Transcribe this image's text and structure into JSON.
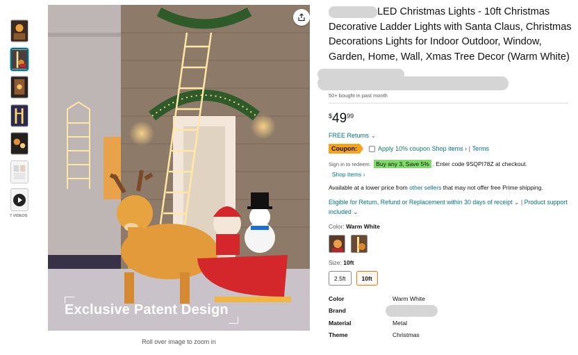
{
  "thumbnails": [
    {
      "name": "thumb-1"
    },
    {
      "name": "thumb-2"
    },
    {
      "name": "thumb-3"
    },
    {
      "name": "thumb-4"
    },
    {
      "name": "thumb-5"
    },
    {
      "name": "thumb-6"
    },
    {
      "name": "thumb-video"
    }
  ],
  "videos_label": "7 VIDEOS",
  "main_image": {
    "caption": "Exclusive Patent Design",
    "zoom_hint": "Roll over image to zoom in"
  },
  "product": {
    "title": "LED Christmas Lights - 10ft Christmas Decorative Ladder Lights with Santa Claus, Christmas Decorations Lights for Indoor Outdoor, Window, Garden, Home, Wall, Xmas Tree Decor (Warm White)",
    "bought": "50+ bought in past month",
    "price": {
      "currency": "$",
      "whole": "49",
      "fraction": "99"
    },
    "returns": "FREE Returns",
    "coupon": {
      "badge": "Coupon:",
      "text": "Apply 10% coupon",
      "shop_items": "Shop items ›",
      "separator": "|",
      "terms": "Terms"
    },
    "promo": {
      "prefix": "Sign in to redeem.",
      "badge": "Buy any 3, Save 5%",
      "suffix": ". Enter code 9SQPI78Z at checkout.",
      "shop_items": "Shop items ›"
    },
    "lower_price": {
      "before": "Available at a lower price from ",
      "link": "other sellers",
      "after": " that may not offer free Prime shipping."
    },
    "eligibility": {
      "text": "Eligible for Return, Refund or Replacement within 30 days of receipt",
      "chev": "⌄",
      "sep": "|",
      "support": "Product support included"
    },
    "color": {
      "label": "Color:",
      "value": "Warm White"
    },
    "size": {
      "label": "Size:",
      "value": "10ft",
      "options": [
        "2.5ft",
        "10ft"
      ]
    },
    "specs": [
      {
        "key": "Color",
        "value": "Warm White"
      },
      {
        "key": "Brand",
        "value": ""
      },
      {
        "key": "Material",
        "value": "Metal"
      },
      {
        "key": "Theme",
        "value": "Christmas"
      }
    ]
  },
  "colors": {
    "link": "#007185",
    "price_text": "#0f1111",
    "coupon_badge": "#f7a21b",
    "promo_badge": "#7fda69",
    "selected_size": "#e77600"
  }
}
